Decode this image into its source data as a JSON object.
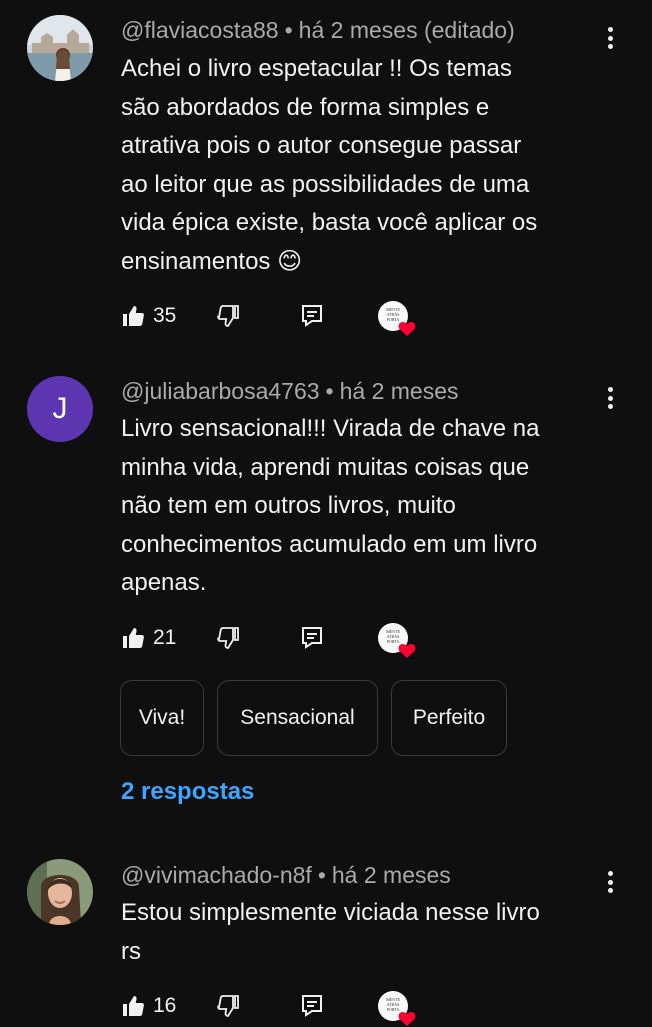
{
  "comments": [
    {
      "handle": "@flaviacosta88",
      "separator": "•",
      "time": "há 2 meses (editado)",
      "text_lines": [
        "Achei o livro espetacular !! Os temas",
        "são abordados de forma simples e",
        "atrativa pois o autor consegue passar",
        "ao leitor que as possibilidades de uma",
        "vida épica existe, basta você aplicar os",
        "ensinamentos 😊"
      ],
      "likes": "35",
      "avatar_letter": ""
    },
    {
      "handle": "@juliabarbosa4763",
      "separator": "•",
      "time": "há 2 meses",
      "text_lines": [
        "Livro sensacional!!! Virada de chave na",
        "minha vida, aprendi muitas coisas que",
        "não tem em outros livros, muito",
        "conhecimentos acumulado em um livro",
        "apenas."
      ],
      "likes": "21",
      "avatar_letter": "J",
      "suggested_replies": [
        "Viva!",
        "Sensacional",
        "Perfeito"
      ],
      "replies_link": "2 respostas"
    },
    {
      "handle": "@vivimachado-n8f",
      "separator": "•",
      "time": "há 2 meses",
      "text_lines": [
        "Estou simplesmente viciada nesse livro",
        "rs"
      ],
      "likes": "16",
      "avatar_letter": ""
    }
  ],
  "creator_heart_logo_text": [
    "MENTE",
    "ATRÁS",
    "PORTA"
  ],
  "colors": {
    "background": "#0f0f0f",
    "text": "#f1f1f1",
    "meta": "#aaaaaa",
    "link": "#3ea6ff",
    "heart": "#ff0033",
    "avatar_j": "#5e35b1"
  },
  "icons": [
    "like-icon",
    "dislike-icon",
    "reply-icon",
    "creator-heart-icon",
    "more-options-icon"
  ]
}
